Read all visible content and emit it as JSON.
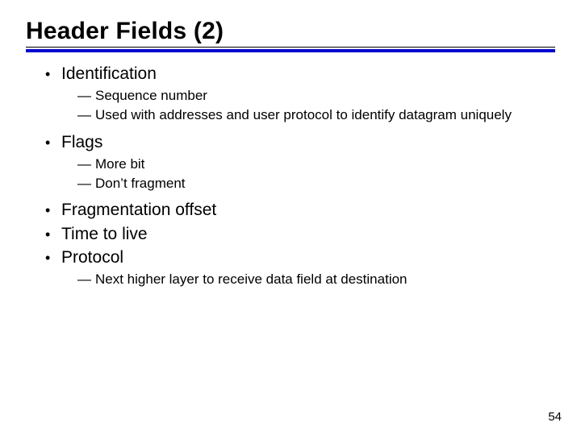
{
  "title": "Header Fields (2)",
  "page_number": "54",
  "bullets": [
    {
      "text": "Identification",
      "subs": [
        "Sequence number",
        "Used with addresses and user protocol to identify datagram uniquely"
      ]
    },
    {
      "text": "Flags",
      "subs": [
        "More bit",
        "Don’t fragment"
      ]
    },
    {
      "text": "Fragmentation offset",
      "subs": []
    },
    {
      "text": "Time to live",
      "subs": []
    },
    {
      "text": "Protocol",
      "subs": [
        "Next higher layer to receive data field at destination"
      ]
    }
  ]
}
